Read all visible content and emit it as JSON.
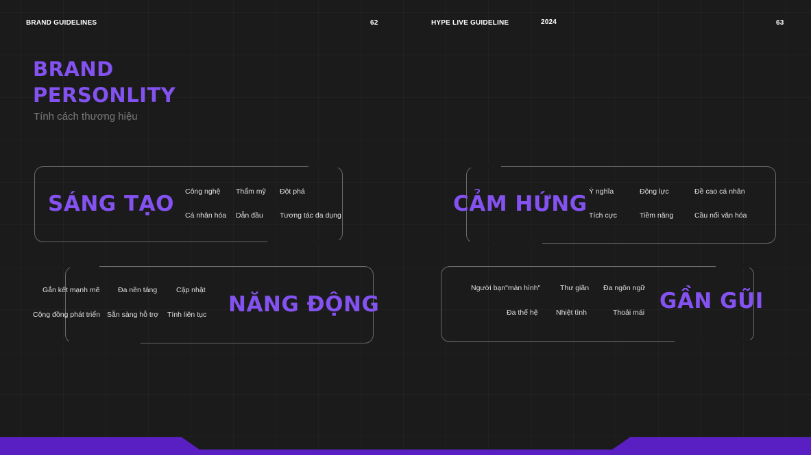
{
  "header": {
    "left_title": "BRAND GUIDELINES",
    "page_left": "62",
    "center_title": "HYPE LIVE GUIDELINE",
    "year": "2024",
    "page_right": "63"
  },
  "section": {
    "title_line1": "BRAND",
    "title_line2": "PERSONLITY",
    "subtitle": "Tính cách thương hiệu"
  },
  "traits": {
    "sang_tao": {
      "name": "SÁNG TẠO",
      "keywords": [
        "Công nghệ",
        "Thẩm mỹ",
        "Đột phá",
        "Cá nhân hóa",
        "Dẫn đầu",
        "Tương tác đa dụng"
      ]
    },
    "cam_hung": {
      "name": "CẢM HỨNG",
      "keywords": [
        "Ý nghĩa",
        "Động lực",
        "Đề cao cá nhân",
        "Tích cực",
        "Tiềm năng",
        "Cầu nối văn hóa"
      ]
    },
    "nang_dong": {
      "name": "NĂNG ĐỘNG",
      "keywords": [
        "Gắn kết mạnh mẽ",
        "Đa nền tảng",
        "Cập nhật",
        "Cộng đồng phát triển",
        "Sẵn sàng hỗ trợ",
        "Tính liên tục"
      ]
    },
    "gan_gui": {
      "name": "GẦN GŨI",
      "keywords": [
        "Người bạn\"màn hình\"",
        "Thư giãn",
        "Đa ngôn ngữ",
        "Đa thế hệ",
        "Nhiệt tình",
        "Thoải mái"
      ]
    }
  },
  "colors": {
    "accent": "#8452f0",
    "background": "#1b1b1b",
    "footer_bar": "#5a1fc2"
  }
}
